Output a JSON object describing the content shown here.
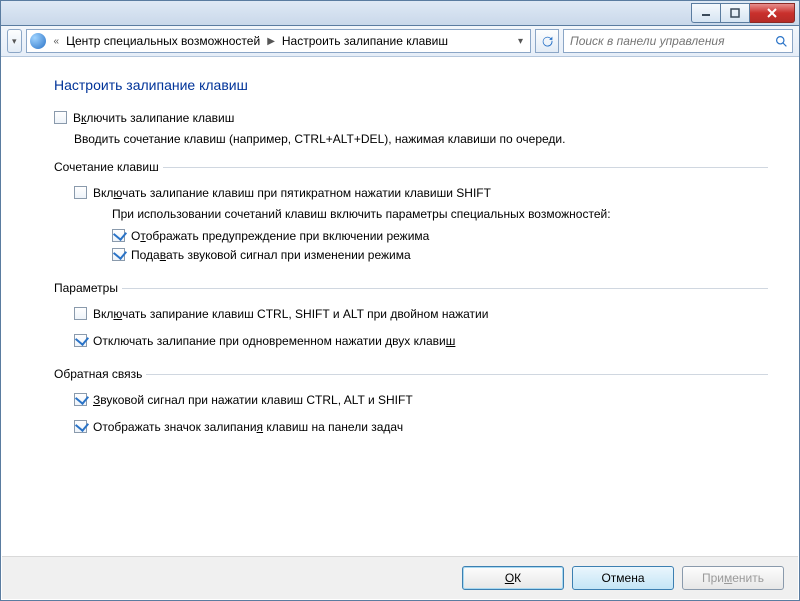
{
  "titlebar": {},
  "addressbar": {
    "breadcrumb": [
      "Центр специальных возможностей",
      "Настроить залипание клавиш"
    ],
    "search_placeholder": "Поиск в панели управления"
  },
  "page": {
    "title": "Настроить залипание клавиш",
    "enable": {
      "checked": false,
      "label_pre": "В",
      "label_acc": "к",
      "label_post": "лючить залипание клавиш"
    },
    "enable_desc": "Вводить сочетание клавиш (например, CTRL+ALT+DEL), нажимая клавиши по очереди."
  },
  "groups": {
    "shortcut": {
      "legend": "Сочетание клавиш",
      "five_shift": {
        "checked": false,
        "pre": "Вкл",
        "acc": "ю",
        "post": "чать залипание клавиш при пятикратном нажатии клавиши SHIFT"
      },
      "note": "При использовании сочетаний клавиш включить параметры специальных возможностей:",
      "warn": {
        "checked": true,
        "pre": "О",
        "acc": "т",
        "post": "ображать предупреждение при включении режима"
      },
      "sound": {
        "checked": true,
        "pre": "Пода",
        "acc": "в",
        "post": "ать звуковой сигнал при изменении режима"
      }
    },
    "params": {
      "legend": "Параметры",
      "lock": {
        "checked": false,
        "pre": "Вкл",
        "acc": "ю",
        "post": "чать запирание клавиш CTRL, SHIFT и ALT при двойном нажатии"
      },
      "off_two": {
        "checked": true,
        "pre": "Отключать залипание при одновременном нажатии двух клави",
        "acc": "ш",
        "post": ""
      }
    },
    "feedback": {
      "legend": "Обратная связь",
      "beep": {
        "checked": true,
        "pre": "",
        "acc": "З",
        "post": "вуковой сигнал при нажатии клавиш CTRL, ALT и SHIFT"
      },
      "tray": {
        "checked": true,
        "pre": "Отображать значок залипани",
        "acc": "я",
        "post": " клавиш на панели задач"
      }
    }
  },
  "buttons": {
    "ok_pre": "",
    "ok_acc": "О",
    "ok_post": "К",
    "cancel": "Отмена",
    "apply_pre": "При",
    "apply_acc": "м",
    "apply_post": "енить"
  }
}
